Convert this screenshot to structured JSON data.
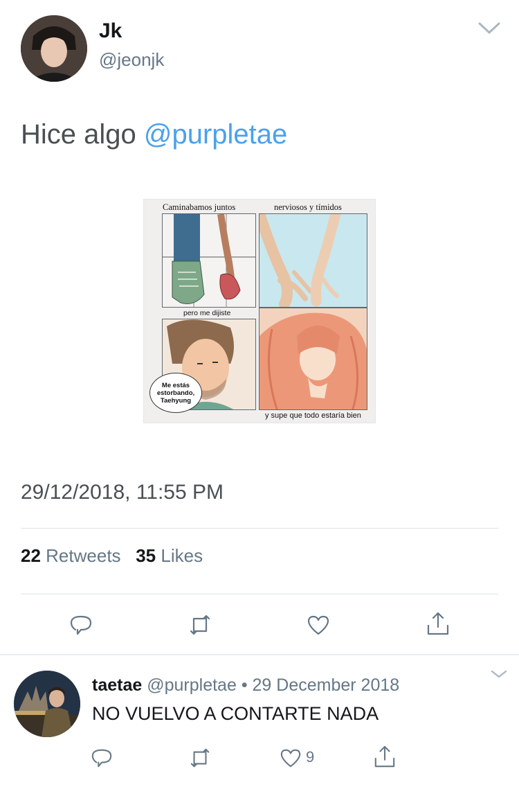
{
  "tweet": {
    "display_name": "Jk",
    "handle": "@jeonjk",
    "text_plain": "Hice algo ",
    "text_mention": "@purpletae",
    "timestamp": "29/12/2018, 11:55 PM",
    "retweets_count": "22",
    "retweets_label": "Retweets",
    "likes_count": "35",
    "likes_label": "Likes"
  },
  "image": {
    "caption_top_left": "Caminabamos juntos",
    "caption_top_right": "nerviosos y tímidos",
    "caption_mid": "pero me dijiste",
    "speech_bubble": "Me estás estorbando, Taehyung",
    "caption_bottom": "y supe que todo estaría bien"
  },
  "reply": {
    "display_name": "taetae",
    "handle": "@purpletae",
    "separator": "•",
    "date": "29 December 2018",
    "text": "NO VUELVO A CONTARTE NADA",
    "like_count": "9"
  },
  "icons": [
    "chevron-down-icon",
    "reply-icon",
    "retweet-icon",
    "like-icon",
    "share-icon"
  ],
  "colors": {
    "link": "#4aa1eb",
    "muted": "#657786",
    "text": "#14171a"
  }
}
